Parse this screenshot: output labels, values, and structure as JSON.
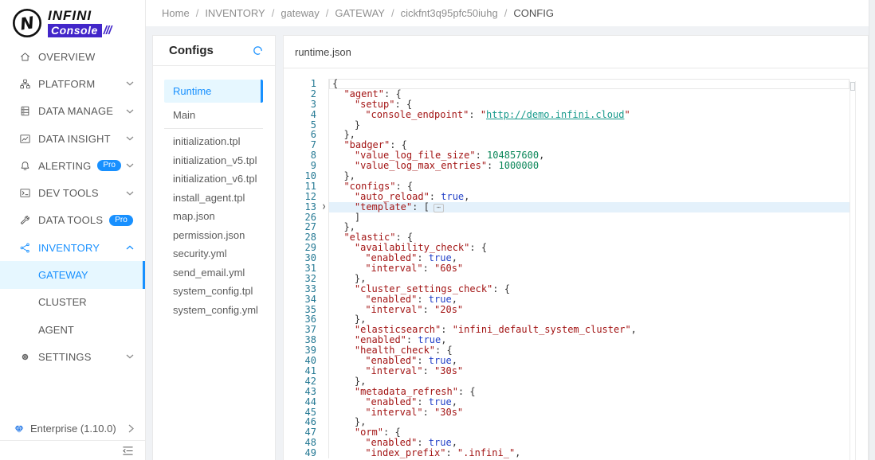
{
  "theme": {
    "accent": "#1890ff",
    "accent_bg": "#e6f7ff",
    "brand_purple": "#4226c9"
  },
  "brand": {
    "name_top": "INFINI",
    "name_bottom": "Console",
    "slashes": "///"
  },
  "breadcrumb": {
    "separator": "/",
    "items": [
      "Home",
      "INVENTORY",
      "gateway",
      "GATEWAY",
      "cickfnt3q95pfc50iuhg",
      "CONFIG"
    ]
  },
  "sidebar": {
    "items": [
      {
        "label": "OVERVIEW",
        "icon": "home-icon"
      },
      {
        "label": "PLATFORM",
        "icon": "platform-icon",
        "chevron": "down"
      },
      {
        "label": "DATA MANAGE",
        "icon": "database-icon",
        "chevron": "down"
      },
      {
        "label": "DATA INSIGHT",
        "icon": "chart-icon",
        "chevron": "down"
      },
      {
        "label": "ALERTING",
        "icon": "bell-icon",
        "chevron": "down",
        "badge": "Pro"
      },
      {
        "label": "DEV TOOLS",
        "icon": "terminal-icon",
        "chevron": "down"
      },
      {
        "label": "DATA TOOLS",
        "icon": "tool-icon",
        "chevron": "down",
        "badge": "Pro"
      },
      {
        "label": "INVENTORY",
        "icon": "share-icon",
        "chevron": "up",
        "active": true,
        "children": [
          {
            "label": "GATEWAY",
            "selected": true
          },
          {
            "label": "CLUSTER"
          },
          {
            "label": "AGENT"
          }
        ]
      },
      {
        "label": "SETTINGS",
        "icon": "gear-icon",
        "chevron": "down"
      }
    ],
    "footer": {
      "label": "Enterprise (1.10.0)",
      "icon": "gem-icon",
      "chevron": "right"
    }
  },
  "configs_panel": {
    "title": "Configs",
    "refresh_icon": "reload-icon",
    "primary_items": [
      {
        "label": "Runtime",
        "selected": true
      },
      {
        "label": "Main"
      }
    ],
    "files": [
      "initialization.tpl",
      "initialization_v5.tpl",
      "initialization_v6.tpl",
      "install_agent.tpl",
      "map.json",
      "permission.json",
      "security.yml",
      "send_email.yml",
      "system_config.tpl",
      "system_config.yml"
    ]
  },
  "editor": {
    "title": "runtime.json",
    "colors": {
      "key": "#a31515",
      "string": "#a31515",
      "number": "#098658",
      "atom": "#2442c8",
      "link": "#189a8c",
      "punct": "#333333",
      "line_number": "#237893",
      "fold_highlight": "#e4f1fb"
    },
    "lines": [
      {
        "n": 1,
        "i": 0,
        "cur": true,
        "t": [
          [
            "p",
            "{"
          ]
        ]
      },
      {
        "n": 2,
        "i": 2,
        "t": [
          [
            "k",
            "\"agent\""
          ],
          [
            "p",
            ": {"
          ]
        ]
      },
      {
        "n": 3,
        "i": 4,
        "t": [
          [
            "k",
            "\"setup\""
          ],
          [
            "p",
            ": {"
          ]
        ]
      },
      {
        "n": 4,
        "i": 6,
        "t": [
          [
            "k",
            "\"console_endpoint\""
          ],
          [
            "p",
            ": "
          ],
          [
            "s",
            "\""
          ],
          [
            "l",
            "http://demo.infini.cloud"
          ],
          [
            "s",
            "\""
          ]
        ]
      },
      {
        "n": 5,
        "i": 4,
        "t": [
          [
            "p",
            "}"
          ]
        ]
      },
      {
        "n": 6,
        "i": 2,
        "t": [
          [
            "p",
            "},"
          ]
        ]
      },
      {
        "n": 7,
        "i": 2,
        "t": [
          [
            "k",
            "\"badger\""
          ],
          [
            "p",
            ": {"
          ]
        ]
      },
      {
        "n": 8,
        "i": 4,
        "t": [
          [
            "k",
            "\"value_log_file_size\""
          ],
          [
            "p",
            ": "
          ],
          [
            "n",
            "104857600"
          ],
          [
            "p",
            ","
          ]
        ]
      },
      {
        "n": 9,
        "i": 4,
        "t": [
          [
            "k",
            "\"value_log_max_entries\""
          ],
          [
            "p",
            ": "
          ],
          [
            "n",
            "1000000"
          ]
        ]
      },
      {
        "n": 10,
        "i": 2,
        "t": [
          [
            "p",
            "},"
          ]
        ]
      },
      {
        "n": 11,
        "i": 2,
        "t": [
          [
            "k",
            "\"configs\""
          ],
          [
            "p",
            ": {"
          ]
        ]
      },
      {
        "n": 12,
        "i": 4,
        "t": [
          [
            "k",
            "\"auto_reload\""
          ],
          [
            "p",
            ": "
          ],
          [
            "a",
            "true"
          ],
          [
            "p",
            ","
          ]
        ]
      },
      {
        "n": 13,
        "i": 4,
        "fold": true,
        "hl": true,
        "t": [
          [
            "k",
            "\"template\""
          ],
          [
            "p",
            ": ["
          ],
          [
            "f",
            "⋯"
          ]
        ]
      },
      {
        "n": 26,
        "i": 4,
        "t": [
          [
            "p",
            "]"
          ]
        ]
      },
      {
        "n": 27,
        "i": 2,
        "t": [
          [
            "p",
            "},"
          ]
        ]
      },
      {
        "n": 28,
        "i": 2,
        "t": [
          [
            "k",
            "\"elastic\""
          ],
          [
            "p",
            ": {"
          ]
        ]
      },
      {
        "n": 29,
        "i": 4,
        "t": [
          [
            "k",
            "\"availability_check\""
          ],
          [
            "p",
            ": {"
          ]
        ]
      },
      {
        "n": 30,
        "i": 6,
        "t": [
          [
            "k",
            "\"enabled\""
          ],
          [
            "p",
            ": "
          ],
          [
            "a",
            "true"
          ],
          [
            "p",
            ","
          ]
        ]
      },
      {
        "n": 31,
        "i": 6,
        "t": [
          [
            "k",
            "\"interval\""
          ],
          [
            "p",
            ": "
          ],
          [
            "s",
            "\"60s\""
          ]
        ]
      },
      {
        "n": 32,
        "i": 4,
        "t": [
          [
            "p",
            "},"
          ]
        ]
      },
      {
        "n": 33,
        "i": 4,
        "t": [
          [
            "k",
            "\"cluster_settings_check\""
          ],
          [
            "p",
            ": {"
          ]
        ]
      },
      {
        "n": 34,
        "i": 6,
        "t": [
          [
            "k",
            "\"enabled\""
          ],
          [
            "p",
            ": "
          ],
          [
            "a",
            "true"
          ],
          [
            "p",
            ","
          ]
        ]
      },
      {
        "n": 35,
        "i": 6,
        "t": [
          [
            "k",
            "\"interval\""
          ],
          [
            "p",
            ": "
          ],
          [
            "s",
            "\"20s\""
          ]
        ]
      },
      {
        "n": 36,
        "i": 4,
        "t": [
          [
            "p",
            "},"
          ]
        ]
      },
      {
        "n": 37,
        "i": 4,
        "t": [
          [
            "k",
            "\"elasticsearch\""
          ],
          [
            "p",
            ": "
          ],
          [
            "s",
            "\"infini_default_system_cluster\""
          ],
          [
            "p",
            ","
          ]
        ]
      },
      {
        "n": 38,
        "i": 4,
        "t": [
          [
            "k",
            "\"enabled\""
          ],
          [
            "p",
            ": "
          ],
          [
            "a",
            "true"
          ],
          [
            "p",
            ","
          ]
        ]
      },
      {
        "n": 39,
        "i": 4,
        "t": [
          [
            "k",
            "\"health_check\""
          ],
          [
            "p",
            ": {"
          ]
        ]
      },
      {
        "n": 40,
        "i": 6,
        "t": [
          [
            "k",
            "\"enabled\""
          ],
          [
            "p",
            ": "
          ],
          [
            "a",
            "true"
          ],
          [
            "p",
            ","
          ]
        ]
      },
      {
        "n": 41,
        "i": 6,
        "t": [
          [
            "k",
            "\"interval\""
          ],
          [
            "p",
            ": "
          ],
          [
            "s",
            "\"30s\""
          ]
        ]
      },
      {
        "n": 42,
        "i": 4,
        "t": [
          [
            "p",
            "},"
          ]
        ]
      },
      {
        "n": 43,
        "i": 4,
        "t": [
          [
            "k",
            "\"metadata_refresh\""
          ],
          [
            "p",
            ": {"
          ]
        ]
      },
      {
        "n": 44,
        "i": 6,
        "t": [
          [
            "k",
            "\"enabled\""
          ],
          [
            "p",
            ": "
          ],
          [
            "a",
            "true"
          ],
          [
            "p",
            ","
          ]
        ]
      },
      {
        "n": 45,
        "i": 6,
        "t": [
          [
            "k",
            "\"interval\""
          ],
          [
            "p",
            ": "
          ],
          [
            "s",
            "\"30s\""
          ]
        ]
      },
      {
        "n": 46,
        "i": 4,
        "t": [
          [
            "p",
            "},"
          ]
        ]
      },
      {
        "n": 47,
        "i": 4,
        "t": [
          [
            "k",
            "\"orm\""
          ],
          [
            "p",
            ": {"
          ]
        ]
      },
      {
        "n": 48,
        "i": 6,
        "t": [
          [
            "k",
            "\"enabled\""
          ],
          [
            "p",
            ": "
          ],
          [
            "a",
            "true"
          ],
          [
            "p",
            ","
          ]
        ]
      },
      {
        "n": 49,
        "i": 6,
        "t": [
          [
            "k",
            "\"index_prefix\""
          ],
          [
            "p",
            ": "
          ],
          [
            "s",
            "\".infini_\""
          ],
          [
            "p",
            ","
          ]
        ]
      }
    ]
  }
}
